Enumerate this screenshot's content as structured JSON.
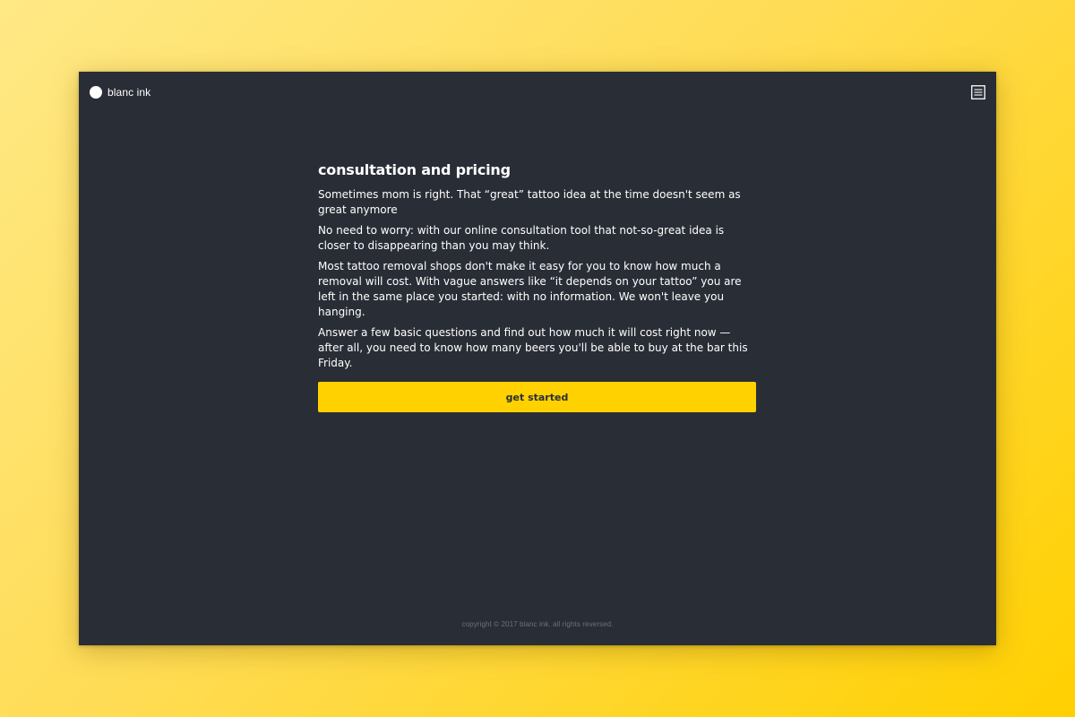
{
  "brand": {
    "name": "blanc ink"
  },
  "header": {
    "menu_icon": "menu-list-icon"
  },
  "main": {
    "title": "consultation and pricing",
    "paragraphs": [
      "Sometimes mom is right. That “great” tattoo idea at the time doesn't seem as great anymore",
      "No need to worry: with our online consultation tool that not-so-great idea is closer to disappearing than you may think.",
      "Most tattoo removal shops don't make it easy for you to know how much a removal will cost. With vague answers like “it depends on your tattoo” you are left in the same place you started: with no information. We won't leave you hanging.",
      "Answer a few basic questions and find out how much it will cost right now — after all, you need to know how many beers you'll be able to buy at the bar this Friday."
    ],
    "cta_label": "get started"
  },
  "footer": {
    "copyright": "copyright © 2017 blanc ink. all rights reversed."
  },
  "colors": {
    "window_bg": "#292d36",
    "accent": "#ffd100",
    "text": "#ffffff",
    "footer_text": "#6d717a"
  }
}
